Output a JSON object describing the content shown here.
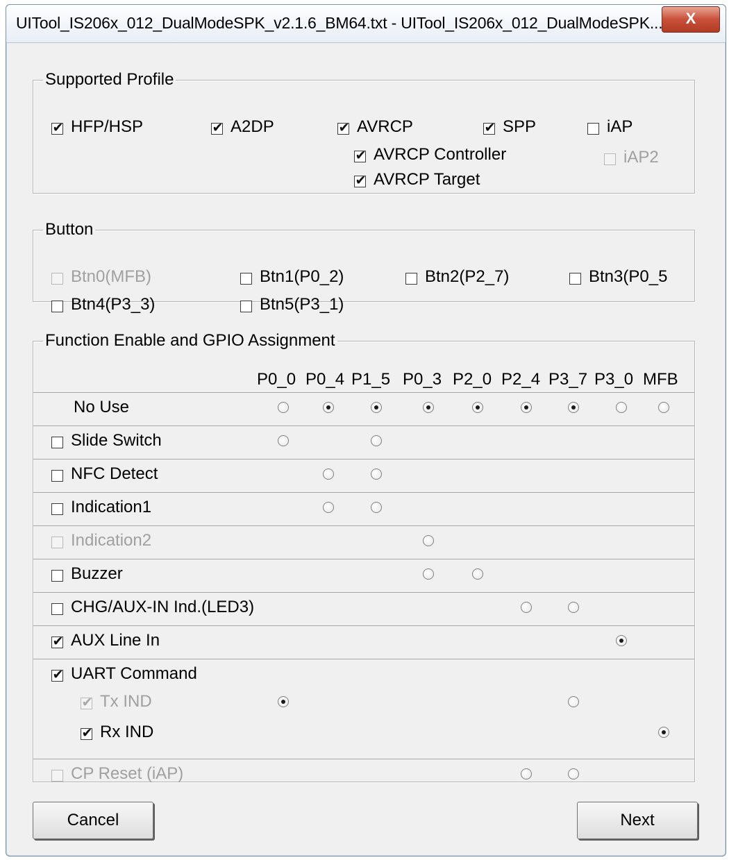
{
  "window": {
    "title": "UITool_IS206x_012_DualModeSPK_v2.1.6_BM64.txt - UITool_IS206x_012_DualModeSPK...",
    "close_label": "X"
  },
  "supported_profile": {
    "legend": "Supported Profile",
    "items": [
      {
        "label": "HFP/HSP",
        "checked": true,
        "enabled": true
      },
      {
        "label": "A2DP",
        "checked": true,
        "enabled": true
      },
      {
        "label": "AVRCP",
        "checked": true,
        "enabled": true
      },
      {
        "label": "SPP",
        "checked": true,
        "enabled": true
      },
      {
        "label": "iAP",
        "checked": false,
        "enabled": true
      },
      {
        "label": "AVRCP Controller",
        "checked": true,
        "enabled": true
      },
      {
        "label": "AVRCP Target",
        "checked": true,
        "enabled": true
      },
      {
        "label": "iAP2",
        "checked": false,
        "enabled": false
      }
    ]
  },
  "button_group": {
    "legend": "Button",
    "items": [
      {
        "label": "Btn0(MFB)",
        "checked": false,
        "enabled": false
      },
      {
        "label": "Btn1(P0_2)",
        "checked": false,
        "enabled": true
      },
      {
        "label": "Btn2(P2_7)",
        "checked": false,
        "enabled": true
      },
      {
        "label": "Btn3(P0_5",
        "checked": false,
        "enabled": true
      },
      {
        "label": "Btn4(P3_3)",
        "checked": false,
        "enabled": true
      },
      {
        "label": "Btn5(P3_1)",
        "checked": false,
        "enabled": true
      }
    ]
  },
  "function_group": {
    "legend": "Function Enable and GPIO Assignment",
    "columns": [
      "P0_0",
      "P0_4",
      "P1_5",
      "P0_3",
      "P2_0",
      "P2_4",
      "P3_7",
      "P3_0",
      "MFB"
    ],
    "rows": [
      {
        "label": "No Use",
        "has_checkbox": false,
        "radios": [
          {
            "col": 0,
            "selected": false
          },
          {
            "col": 1,
            "selected": true
          },
          {
            "col": 2,
            "selected": true
          },
          {
            "col": 3,
            "selected": true
          },
          {
            "col": 4,
            "selected": true
          },
          {
            "col": 5,
            "selected": true
          },
          {
            "col": 6,
            "selected": true
          },
          {
            "col": 7,
            "selected": false
          },
          {
            "col": 8,
            "selected": false
          }
        ]
      },
      {
        "label": "Slide Switch",
        "has_checkbox": true,
        "checked": false,
        "enabled": true,
        "radios": [
          {
            "col": 0,
            "selected": false
          },
          {
            "col": 2,
            "selected": false
          }
        ]
      },
      {
        "label": "NFC Detect",
        "has_checkbox": true,
        "checked": false,
        "enabled": true,
        "radios": [
          {
            "col": 1,
            "selected": false
          },
          {
            "col": 2,
            "selected": false
          }
        ]
      },
      {
        "label": "Indication1",
        "has_checkbox": true,
        "checked": false,
        "enabled": true,
        "radios": [
          {
            "col": 1,
            "selected": false
          },
          {
            "col": 2,
            "selected": false
          }
        ]
      },
      {
        "label": "Indication2",
        "has_checkbox": true,
        "checked": false,
        "enabled": false,
        "radios": [
          {
            "col": 3,
            "selected": false
          }
        ]
      },
      {
        "label": "Buzzer",
        "has_checkbox": true,
        "checked": false,
        "enabled": true,
        "radios": [
          {
            "col": 3,
            "selected": false
          },
          {
            "col": 4,
            "selected": false
          }
        ]
      },
      {
        "label": "CHG/AUX-IN Ind.(LED3)",
        "has_checkbox": true,
        "checked": false,
        "enabled": true,
        "radios": [
          {
            "col": 5,
            "selected": false
          },
          {
            "col": 6,
            "selected": false
          }
        ]
      },
      {
        "label": "AUX Line In",
        "has_checkbox": true,
        "checked": true,
        "enabled": true,
        "radios": [
          {
            "col": 7,
            "selected": true
          }
        ]
      },
      {
        "label": "UART Command",
        "has_checkbox": true,
        "checked": true,
        "enabled": true,
        "radios": [],
        "sub": [
          {
            "label": "Tx IND",
            "checked": true,
            "enabled": false,
            "radios": [
              {
                "col": 0,
                "selected": true
              },
              {
                "col": 6,
                "selected": false
              }
            ]
          },
          {
            "label": "Rx IND",
            "checked": true,
            "enabled": true,
            "radios": [
              {
                "col": 8,
                "selected": true
              }
            ]
          }
        ]
      },
      {
        "label": "CP Reset (iAP)",
        "has_checkbox": true,
        "checked": false,
        "enabled": false,
        "radios": [
          {
            "col": 5,
            "selected": false
          },
          {
            "col": 6,
            "selected": false
          }
        ]
      }
    ]
  },
  "footer": {
    "cancel_label": "Cancel",
    "next_label": "Next"
  }
}
